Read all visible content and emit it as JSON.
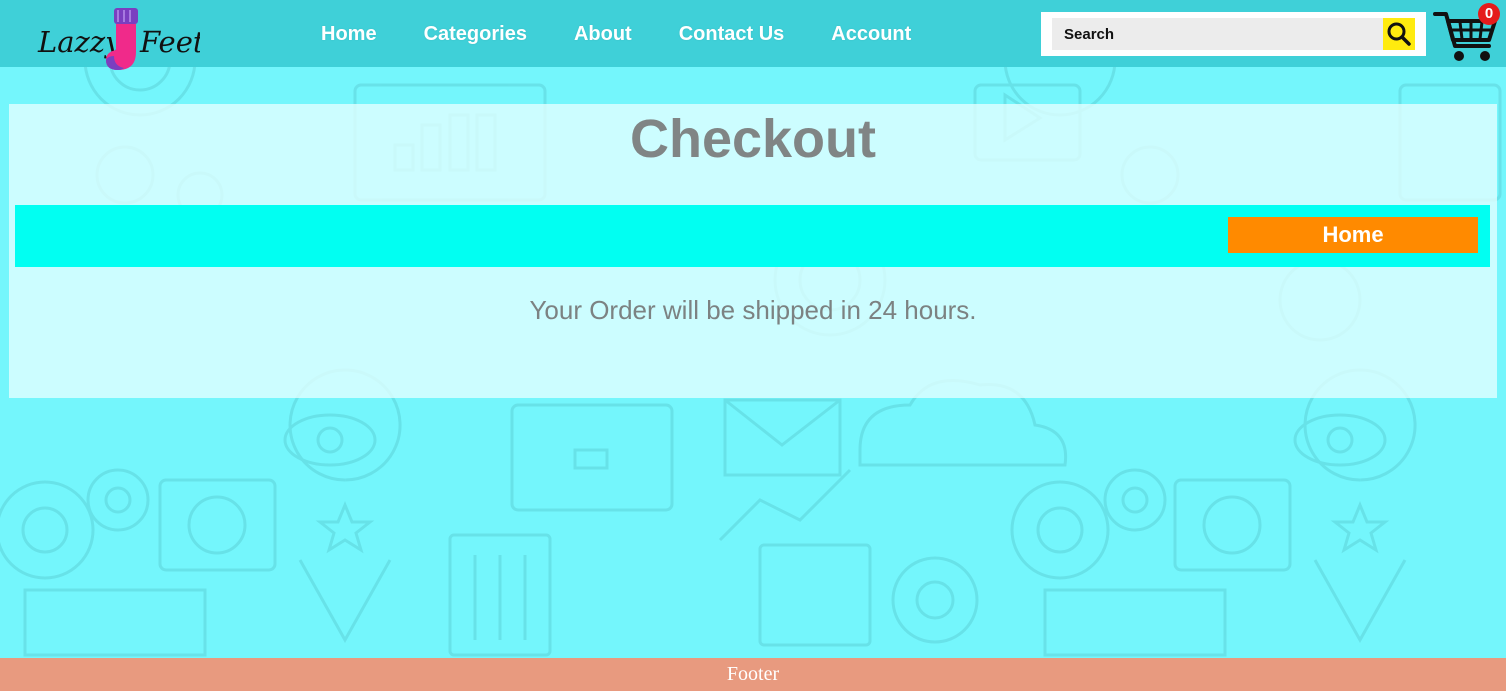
{
  "brand": {
    "logo_text_left": "Lazzy",
    "logo_text_right": "Feet"
  },
  "nav": {
    "items": [
      {
        "label": "Home"
      },
      {
        "label": "Categories"
      },
      {
        "label": "About"
      },
      {
        "label": "Contact Us"
      },
      {
        "label": "Account"
      }
    ]
  },
  "search": {
    "placeholder": "Search",
    "button_icon": "search-icon"
  },
  "cart": {
    "icon": "cart-icon",
    "count": "0"
  },
  "main": {
    "title": "Checkout",
    "home_button_label": "Home",
    "message": "Your Order will be shipped in 24 hours."
  },
  "footer": {
    "text": "Footer"
  },
  "colors": {
    "page_background": "#74f6fc",
    "header_background": "#3fd0d8",
    "breadcrumb_bar": "#01fff2",
    "home_button": "#ff8a00",
    "search_button": "#ffeb0f",
    "cart_badge": "#e51b1b",
    "footer_background": "#e89a7f"
  }
}
